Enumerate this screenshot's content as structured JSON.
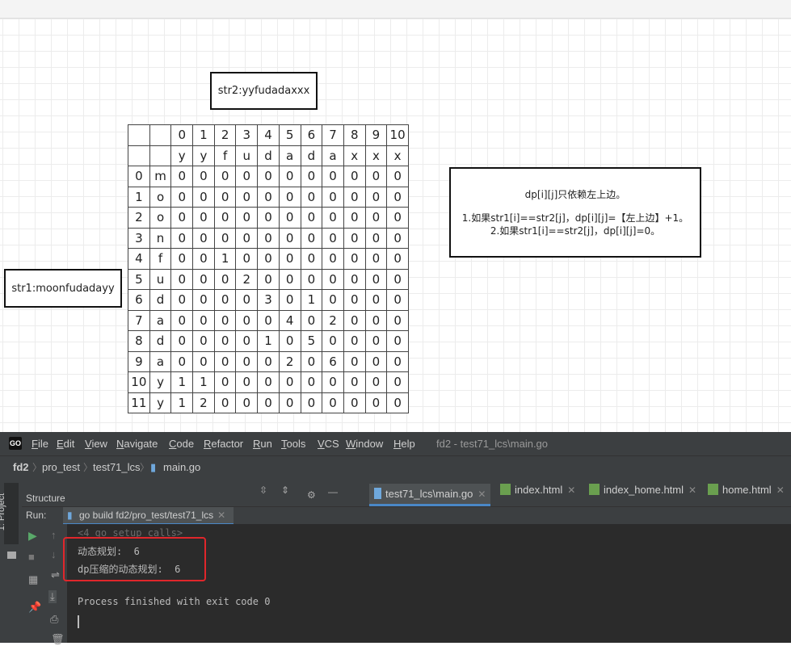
{
  "whiteboard": {
    "str2_label": "str2:yyfudadaxxx",
    "str1_label": "str1:moonfudadayy",
    "note": {
      "line1": "dp[i][j]只依赖左上边。",
      "line2": "1.如果str1[i]==str2[j]，dp[i][j]=【左上边】+1。",
      "line3": "2.如果str1[i]==str2[j]，dp[i][j]=0。"
    },
    "table": {
      "header_index": [
        "",
        "",
        "0",
        "1",
        "2",
        "3",
        "4",
        "5",
        "6",
        "7",
        "8",
        "9",
        "10"
      ],
      "header_chars": [
        "",
        "",
        "y",
        "y",
        "f",
        "u",
        "d",
        "a",
        "d",
        "a",
        "x",
        "x",
        "x"
      ],
      "rows": [
        [
          "0",
          "m",
          "0",
          "0",
          "0",
          "0",
          "0",
          "0",
          "0",
          "0",
          "0",
          "0",
          "0"
        ],
        [
          "1",
          "o",
          "0",
          "0",
          "0",
          "0",
          "0",
          "0",
          "0",
          "0",
          "0",
          "0",
          "0"
        ],
        [
          "2",
          "o",
          "0",
          "0",
          "0",
          "0",
          "0",
          "0",
          "0",
          "0",
          "0",
          "0",
          "0"
        ],
        [
          "3",
          "n",
          "0",
          "0",
          "0",
          "0",
          "0",
          "0",
          "0",
          "0",
          "0",
          "0",
          "0"
        ],
        [
          "4",
          "f",
          "0",
          "0",
          "1",
          "0",
          "0",
          "0",
          "0",
          "0",
          "0",
          "0",
          "0"
        ],
        [
          "5",
          "u",
          "0",
          "0",
          "0",
          "2",
          "0",
          "0",
          "0",
          "0",
          "0",
          "0",
          "0"
        ],
        [
          "6",
          "d",
          "0",
          "0",
          "0",
          "0",
          "3",
          "0",
          "1",
          "0",
          "0",
          "0",
          "0"
        ],
        [
          "7",
          "a",
          "0",
          "0",
          "0",
          "0",
          "0",
          "4",
          "0",
          "2",
          "0",
          "0",
          "0"
        ],
        [
          "8",
          "d",
          "0",
          "0",
          "0",
          "0",
          "1",
          "0",
          "5",
          "0",
          "0",
          "0",
          "0"
        ],
        [
          "9",
          "a",
          "0",
          "0",
          "0",
          "0",
          "0",
          "2",
          "0",
          "6",
          "0",
          "0",
          "0"
        ],
        [
          "10",
          "y",
          "1",
          "1",
          "0",
          "0",
          "0",
          "0",
          "0",
          "0",
          "0",
          "0",
          "0"
        ],
        [
          "11",
          "y",
          "1",
          "2",
          "0",
          "0",
          "0",
          "0",
          "0",
          "0",
          "0",
          "0",
          "0"
        ]
      ]
    }
  },
  "ide": {
    "logo": "GO",
    "menu": [
      {
        "first": "F",
        "rest": "ile"
      },
      {
        "first": "E",
        "rest": "dit"
      },
      {
        "first": "V",
        "rest": "iew"
      },
      {
        "first": "N",
        "rest": "avigate"
      },
      {
        "first": "C",
        "rest": "ode"
      },
      {
        "first": "R",
        "rest": "efactor"
      },
      {
        "first": "R",
        "rest": "un"
      },
      {
        "first": "T",
        "rest": "ools"
      },
      {
        "first": "V",
        "rest": "CS"
      },
      {
        "first": "W",
        "rest": "indow"
      },
      {
        "first": "H",
        "rest": "elp"
      }
    ],
    "window_title": "fd2 - test71_lcs\\main.go",
    "breadcrumbs": [
      "fd2",
      "pro_test",
      "test71_lcs",
      "main.go"
    ],
    "project_tab": "1: Project",
    "structure_label": "Structure",
    "editor_tabs": [
      "test71_lcs\\main.go",
      "index.html",
      "index_home.html",
      "home.html"
    ],
    "run_label": "Run:",
    "run_config": "go build fd2/pro_test/test71_lcs",
    "console": {
      "collapsed": "<4 go setup calls>",
      "line1": "动态规划:  6",
      "line2": "dp压缩的动态规划:  6",
      "line3": "Process finished with exit code 0"
    },
    "colors": {
      "highlight": "#e0262b",
      "accent": "#4a88c7",
      "background": "#2b2b2b"
    }
  }
}
